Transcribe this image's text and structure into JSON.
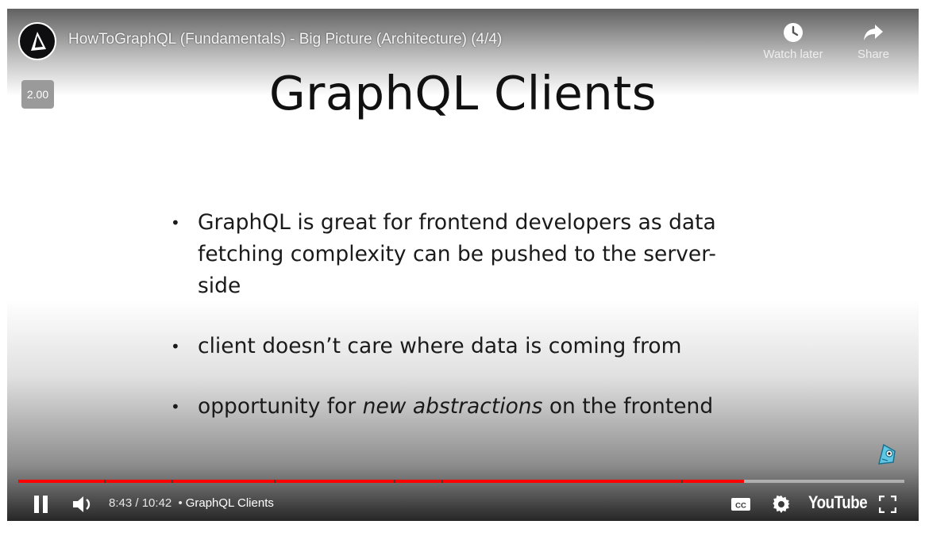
{
  "video": {
    "title": "HowToGraphQL (Fundamentals) - Big Picture (Architecture) (4/4)",
    "playback_speed": "2.00"
  },
  "top_actions": {
    "watch_later": {
      "label": "Watch later",
      "icon": "clock-icon"
    },
    "share": {
      "label": "Share",
      "icon": "share-arrow-icon"
    }
  },
  "slide": {
    "title": "GraphQL Clients",
    "bullets": [
      {
        "lines": [
          "GraphQL is great for frontend developers as data",
          "fetching complexity can be pushed to the server-",
          "side"
        ]
      },
      {
        "text": "client doesn’t care where data is coming from"
      },
      {
        "before": "opportunity for ",
        "emphasis": "new abstractions",
        "after": " on the frontend"
      }
    ]
  },
  "controls": {
    "current_time": "8:43",
    "duration": "10:42",
    "time_separator": "/",
    "chapter_dot": "•",
    "chapter": "GraphQL Clients",
    "youtube_label": "YouTube",
    "progress_fraction": 0.819,
    "icons": [
      "pause-icon",
      "volume-icon",
      "captions-icon",
      "settings-gear-icon",
      "youtube-logo",
      "fullscreen-icon"
    ]
  },
  "colors": {
    "progress_red": "#ff0000",
    "speed_badge": "#9a9a9a"
  }
}
